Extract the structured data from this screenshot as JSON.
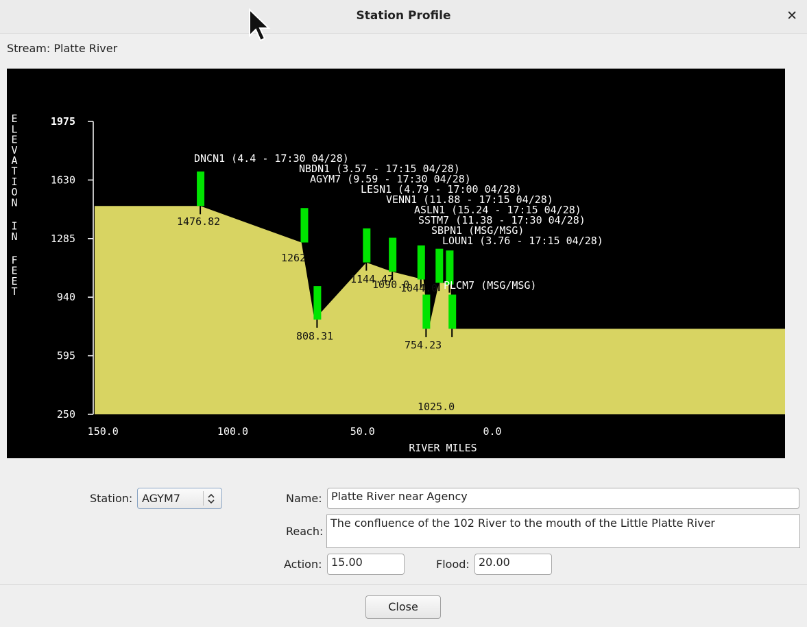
{
  "window": {
    "title": "Station Profile"
  },
  "stream_label": "Stream: Platte River",
  "chart_data": {
    "type": "area",
    "ylabel": "ELEVATION IN FEET",
    "xlabel": "RIVER MILES",
    "y_ticks": [
      "1975",
      "1630",
      "1285",
      "940",
      "595",
      "250"
    ],
    "y_tick_values": [
      1975,
      1630,
      1285,
      940,
      595,
      250
    ],
    "x_ticks": [
      "150.0",
      "100.0",
      "50.0",
      "0.0"
    ],
    "x_tick_values": [
      150,
      100,
      50,
      0
    ],
    "ylim": [
      250,
      1975
    ],
    "x_reversed": true,
    "colors": {
      "background": "#000000",
      "fill": "#d8d462",
      "station": "#00e400",
      "text": "#ffffff",
      "axis": "#ffffff"
    },
    "profile": [
      [
        153,
        1476.82
      ],
      [
        112,
        1476.82
      ],
      [
        73,
        1262
      ],
      [
        68,
        808.31
      ],
      [
        48,
        1144.47
      ],
      [
        38,
        1090
      ],
      [
        26,
        1044
      ],
      [
        24,
        754.23
      ],
      [
        20,
        1025
      ],
      [
        15.5,
        1025
      ],
      [
        15,
        754.23
      ],
      [
        -114,
        754.23
      ]
    ],
    "stations": [
      {
        "id": "DNCN1",
        "label": "DNCN1 (4.4 - 17:30 04/28)",
        "x": 112,
        "y_bottom": 1476.82,
        "y_top": 1680,
        "value_label": "1476.82"
      },
      {
        "id": "NBDN1",
        "label": "NBDN1 (3.57 - 17:15 04/28)",
        "x": 72,
        "y_bottom": 1262,
        "y_top": 1465,
        "value_label": "1262"
      },
      {
        "id": "AGYM7",
        "label": "AGYM7 (9.59 - 17:30 04/28)",
        "x": 67,
        "y_bottom": 808.31,
        "y_top": 1005,
        "value_label": "808.31"
      },
      {
        "id": "LESN1",
        "label": "LESN1 (4.79 - 17:00 04/28)",
        "x": 48,
        "y_bottom": 1144.47,
        "y_top": 1345,
        "value_label": "1144.47"
      },
      {
        "id": "VENN1",
        "label": "VENN1 (11.88 - 17:15 04/28)",
        "x": 38,
        "y_bottom": 1090,
        "y_top": 1290,
        "value_label": "1090.0"
      },
      {
        "id": "ASLN1",
        "label": "ASLN1 (15.24 - 17:15 04/28)",
        "x": 27,
        "y_bottom": 1044,
        "y_top": 1245,
        "value_label": "1044.0"
      },
      {
        "id": "SSTM7",
        "label": "SSTM7 (11.38 - 17:30 04/28)",
        "x": 25,
        "y_bottom": 754.23,
        "y_top": 955,
        "value_label": "754.23"
      },
      {
        "id": "SBPN1",
        "label": "SBPN1 (MSG/MSG)",
        "x": 20,
        "y_bottom": 1025,
        "y_top": 1225,
        "value_label": ""
      },
      {
        "id": "LOUN1",
        "label": "LOUN1 (3.76 - 17:15 04/28)",
        "x": 16,
        "y_bottom": 1015,
        "y_top": 1215,
        "value_label": ""
      },
      {
        "id": "PLCM7",
        "label": "PLCM7 (MSG/MSG)",
        "x": 15,
        "y_bottom": 754.23,
        "y_top": 955,
        "value_label": "1025.0"
      }
    ]
  },
  "form": {
    "station_label": "Station:",
    "station_value": "AGYM7",
    "name_label": "Name:",
    "name_value": "Platte River near Agency",
    "reach_label": "Reach:",
    "reach_value": "The confluence of the 102 River to the mouth of the Little Platte River",
    "action_label": "Action:",
    "action_value": "15.00",
    "flood_label": "Flood:",
    "flood_value": "20.00"
  },
  "buttons": {
    "close": "Close"
  }
}
